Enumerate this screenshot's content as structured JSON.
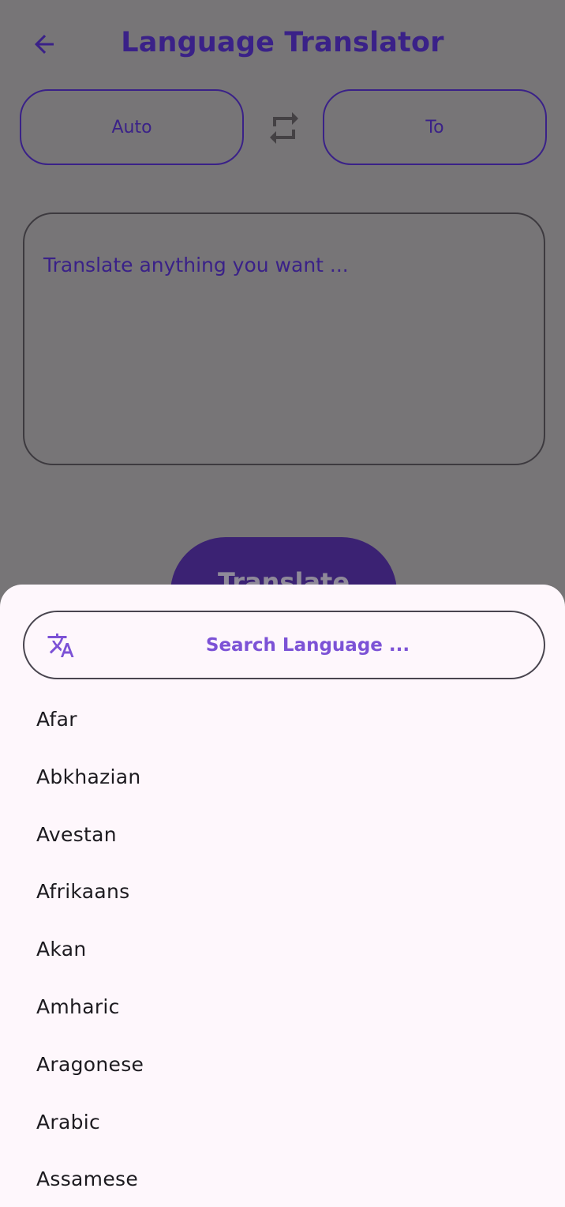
{
  "app_bar": {
    "title": "Language Translator",
    "back_icon": "arrow-left-icon"
  },
  "language_selector": {
    "from_label": "Auto",
    "to_label": "To",
    "swap_icon": "swap-arrows-icon"
  },
  "input": {
    "placeholder": "Translate anything you want ..."
  },
  "translate_button": {
    "label": "Translate"
  },
  "bottom_sheet": {
    "search": {
      "icon": "translate-icon",
      "placeholder": "Search Language ..."
    },
    "languages": [
      "Afar",
      "Abkhazian",
      "Avestan",
      "Afrikaans",
      "Akan",
      "Amharic",
      "Aragonese",
      "Arabic",
      "Assamese"
    ]
  },
  "colors": {
    "primary": "#3a2188",
    "accent": "#7c52d6",
    "scrim_background": "#777577",
    "sheet_background": "#fef7fc",
    "text": "#1d1b20"
  }
}
